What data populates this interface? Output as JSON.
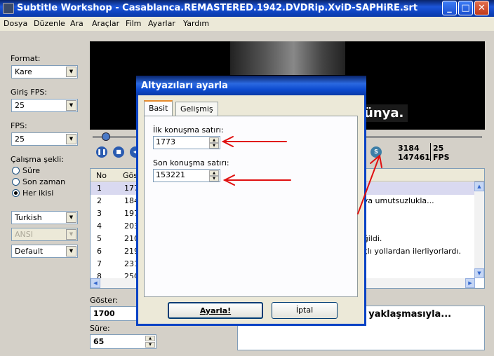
{
  "window": {
    "title": "Subtitle Workshop - Casablanca.REMASTERED.1942.DVDRip.XviD-SAPHiRE.srt"
  },
  "menu": [
    "Dosya",
    "Düzenle",
    "Ara",
    "Araçlar",
    "Film",
    "Ayarlar",
    "Yardım"
  ],
  "left": {
    "format_label": "Format:",
    "format_value": "Kare",
    "input_fps_label": "Giriş FPS:",
    "input_fps_value": "25",
    "fps_label": "FPS:",
    "fps_value": "25",
    "mode_label": "Çalışma şekli:",
    "modes": [
      "Süre",
      "Son zaman",
      "Her ikisi"
    ],
    "selected_mode": "Her ikisi",
    "language": "Turkish",
    "charset": "ANSI",
    "preset": "Default"
  },
  "player": {
    "subtitle_text": "ünya.",
    "frame_a": "3184",
    "frame_b": "147461",
    "fps": "25",
    "fps_unit": "FPS",
    "s_button": "S"
  },
  "list": {
    "columns": [
      "No",
      "Göst"
    ],
    "rows": [
      {
        "no": "1",
        "show": "177",
        "text": ""
      },
      {
        "no": "2",
        "show": "184",
        "text": "eya umutsuzlukla..."
      },
      {
        "no": "3",
        "show": "197",
        "text": ""
      },
      {
        "no": "4",
        "show": "203",
        "text": ""
      },
      {
        "no": "5",
        "show": "210",
        "text": "eğildi."
      },
      {
        "no": "6",
        "show": "219",
        "text": "açlı yollardan ilerliyorlardı."
      },
      {
        "no": "7",
        "show": "231",
        "text": ""
      },
      {
        "no": "8",
        "show": "250",
        "text": ""
      }
    ]
  },
  "bottom": {
    "show_label": "Göster:",
    "show_value": "1700",
    "duration_label": "Süre:",
    "duration_value": "65",
    "text_preview": "ın yaklaşmasıyla..."
  },
  "dialog": {
    "title": "Altyazıları ayarla",
    "tabs": [
      "Basit",
      "Gelişmiş"
    ],
    "first_label": "İlk konuşma satırı:",
    "first_value": "1773",
    "last_label": "Son konuşma satırı:",
    "last_value": "153221",
    "ok": "Ayarla!",
    "cancel": "İptal"
  },
  "colors": {
    "accent": "#0a3aa8",
    "annotation": "#e01010"
  }
}
